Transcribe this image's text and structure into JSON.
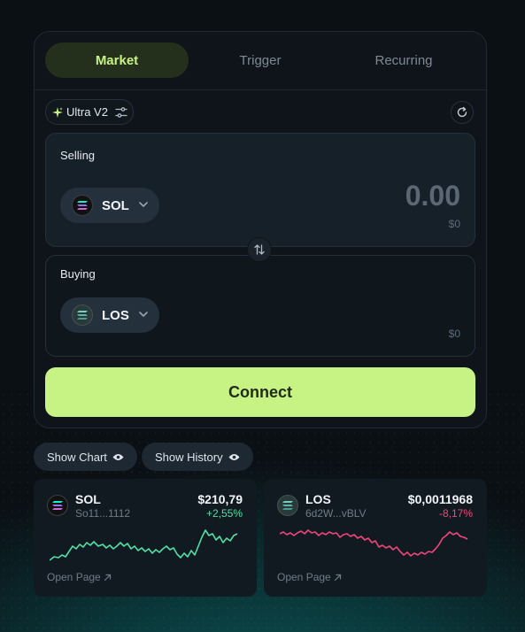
{
  "tabs": [
    {
      "label": "Market",
      "active": true
    },
    {
      "label": "Trigger",
      "active": false
    },
    {
      "label": "Recurring",
      "active": false
    }
  ],
  "router": {
    "label": "Ultra V2",
    "icon": "sparkle-icon",
    "settings_icon": "sliders-icon"
  },
  "refresh_icon": "refresh-icon",
  "selling": {
    "label": "Selling",
    "token": "SOL",
    "amount": "0.00",
    "usd": "$0"
  },
  "buying": {
    "label": "Buying",
    "token": "LOS",
    "usd": "$0"
  },
  "swap_icon": "swap-arrows-icon",
  "connect_label": "Connect",
  "show_chart_label": "Show Chart",
  "show_history_label": "Show History",
  "cards": [
    {
      "name": "SOL",
      "address": "So11...1112",
      "price": "$210,79",
      "change": "+2,55%",
      "direction": "up",
      "open_label": "Open Page"
    },
    {
      "name": "LOS",
      "address": "6d2W...vBLV",
      "price": "$0,0011968",
      "change": "-8,17%",
      "direction": "down",
      "open_label": "Open Page"
    }
  ],
  "colors": {
    "accent": "#c7f284",
    "positive": "#4fe0a5",
    "negative": "#f0457b"
  }
}
